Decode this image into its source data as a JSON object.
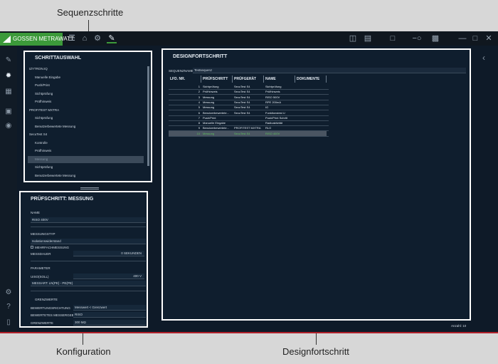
{
  "captions": {
    "top": "Sequenzschritte",
    "bottom_left": "Konfiguration",
    "bottom_right": "Designfortschritt"
  },
  "app": {
    "logo_text": "GOSSEN METRAWATT",
    "accent": "#3c9a3a",
    "border_color": "#b0202a"
  },
  "toolbar_icons": [
    "menu-icon",
    "home-icon",
    "settings-icon",
    "edit-icon"
  ],
  "window_icons": [
    "panel-icon",
    "trash-icon",
    "cursor-icon",
    "zoom-icon",
    "keyboard-icon",
    "minimize-icon",
    "maximize-icon",
    "close-icon"
  ],
  "sidebar_icons": [
    "wrench-icon",
    "gear-icon",
    "chart-icon",
    "calendar-icon",
    "globe-icon",
    "settings-small-icon",
    "help-icon",
    "delete-icon"
  ],
  "schrittauswahl": {
    "title": "SCHRITTAUSWAHL",
    "items": [
      {
        "label": "IZYTRON.IQ",
        "level": 0
      },
      {
        "label": "Manuelle Eingabe",
        "level": 1
      },
      {
        "label": "Push/Print",
        "level": 1
      },
      {
        "label": "Sichtprüfung",
        "level": 1
      },
      {
        "label": "Prüfhinweis",
        "level": 1
      },
      {
        "label": "PROFITEST MXTRA",
        "level": 0
      },
      {
        "label": "Sichtprüfung",
        "level": 1
      },
      {
        "label": "Benutzerbewertete Messung",
        "level": 1
      },
      {
        "label": "SecuTest S4",
        "level": 0
      },
      {
        "label": "Kontrolle",
        "level": 1
      },
      {
        "label": "Prüfhinweis",
        "level": 1
      },
      {
        "label": "Messung",
        "level": 1,
        "selected": true
      },
      {
        "label": "Sichtprüfung",
        "level": 1
      },
      {
        "label": "Benutzerbewertete Messung",
        "level": 1
      }
    ]
  },
  "konfiguration": {
    "title": "PRÜFSCHRITT: MESSUNG",
    "name_label": "NAME",
    "name_value": "RISO 400V",
    "messungstyp_label": "MESSUNGSTYP",
    "messungstyp_value": "Isolationswiderstand",
    "mehrfach_label": "MEHRFACHMESSUNG",
    "messdauer_label": "MESSDAUER",
    "messdauer_value": "0 SEKUNDEN",
    "parameter_label": "PARAMETER",
    "uiso_label": "UISO(SOLL)",
    "uiso_value": "400 V",
    "messart_label": "MESSART: LN(PE) - PE(PE)",
    "grenzwerte_label": "GRENZWERTE",
    "bewertung_label": "BEWERTUNGSRICHTUNG",
    "bewertung_value": "Messwert < Grenzwert",
    "bewertetes_label": "BEWERTETES MESSERGEBNIS",
    "bewertetes_value": "RISO",
    "grenzwerte_row_label": "GRENZWERTE",
    "grenzwerte_row_value": "300 MΩ"
  },
  "designfortschritt": {
    "title": "DESIGNFORTSCHRITT",
    "sequenzname_label": "SEQUENZNAME",
    "sequenzname_value": "Testsequenz",
    "columns": [
      "LFD. NR.",
      "PRÜFSCHRITT",
      "PRÜFGERÄT",
      "NAME",
      "DOKUMENTE"
    ],
    "rows": [
      [
        "1",
        "Sichtprüfung",
        "SecuTest S4",
        "Sichtprüfung",
        ""
      ],
      [
        "2",
        "Prüfhinweis",
        "SecuTest S4",
        "Prüfhinweis",
        ""
      ],
      [
        "3",
        "Messung",
        "SecuTest S4",
        "RISO 500V",
        ""
      ],
      [
        "4",
        "Messung",
        "SecuTest S4",
        "RPE 200mA",
        ""
      ],
      [
        "5",
        "Messung",
        "SecuTest S4",
        "IG",
        ""
      ],
      [
        "6",
        "Benutzerbewertete...",
        "SecuTest S4",
        "Funktionstest U",
        ""
      ],
      [
        "7",
        "Push/Print",
        "",
        "Push/Print Schritt",
        ""
      ],
      [
        "8",
        "Manuelle Eingabe",
        "",
        "Radioaktivität",
        ""
      ],
      [
        "9",
        "Benutzerbewertete...",
        "PROFITEST MXTRA",
        "RLO",
        ""
      ],
      [
        "10",
        "Messung",
        "SecuTest S4",
        "RISO 400V",
        ""
      ]
    ],
    "anzahl": "Anzahl: 10"
  }
}
